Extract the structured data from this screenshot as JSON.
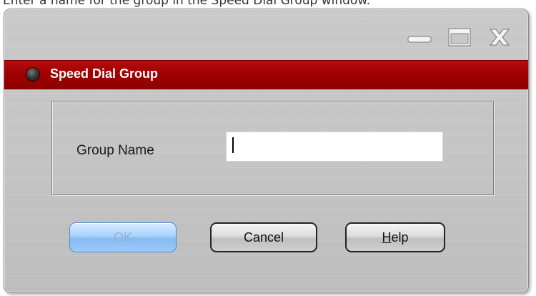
{
  "caption": "Enter a name for the group in the Speed Dial Group window.",
  "window": {
    "title": "Speed Dial Group",
    "controls": [
      "minimize-icon",
      "maximize-icon",
      "close-icon"
    ]
  },
  "form": {
    "group_name_label": "Group Name",
    "group_name_value": "",
    "group_name_placeholder": ""
  },
  "buttons": {
    "ok": "OK",
    "cancel": "Cancel",
    "help_mnemonic": "H",
    "help_rest": "elp"
  },
  "colors": {
    "titlebar": "#a00000",
    "window_bg": "#c4c4c4",
    "ok_button": "#9fcaf7"
  }
}
